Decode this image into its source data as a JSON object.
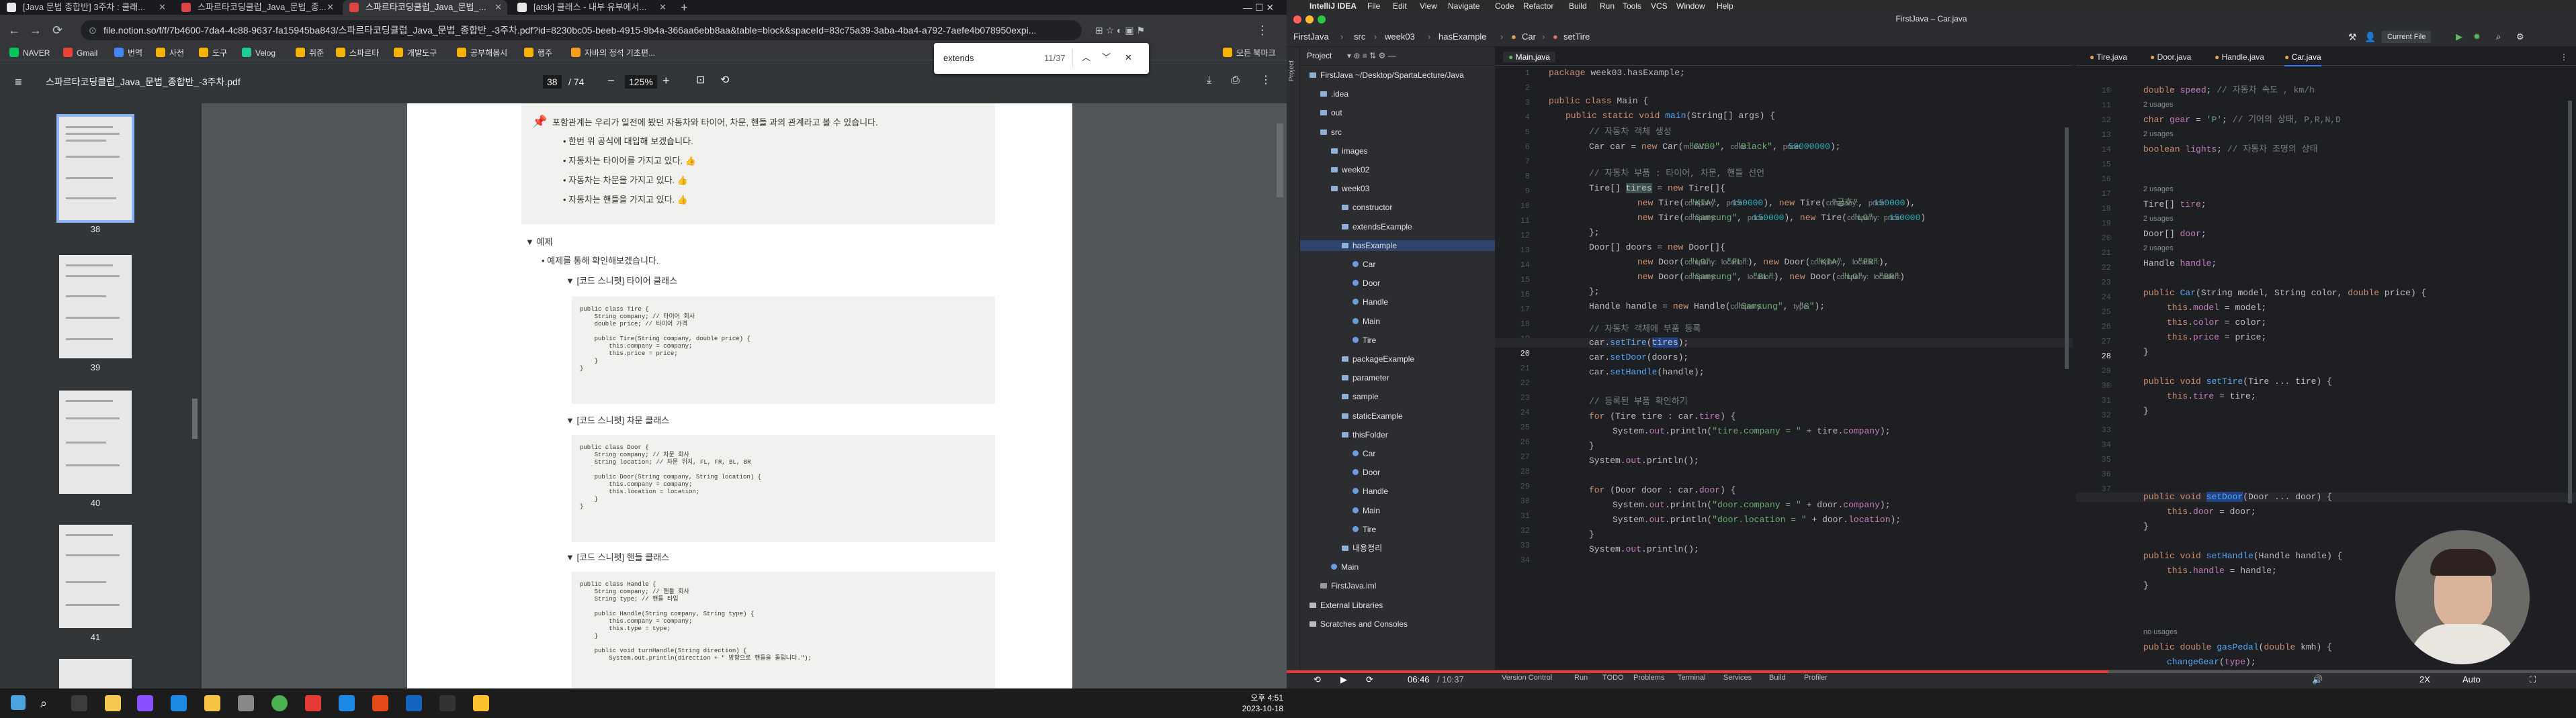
{
  "browser": {
    "tabs": [
      {
        "label": "[Java 문법 종합반] 3주차 : 클래..."
      },
      {
        "label": "스파르타코딩클럽_Java_문법_종..."
      },
      {
        "label": "스파르타코딩클럽_Java_문법_..."
      },
      {
        "label": "[atsk] 클래스 - 내부 유부에서..."
      }
    ],
    "url": "file.notion.so/f/f/7b4600-7da4-4c88-9637-fa15945ba843/스파르타코딩클럽_Java_문법_종합반_-3주차.pdf?id=8230bc05-beeb-4915-9b4a-366aa6ebb8aa&table=block&spaceId=83c75a39-3aba-4ba4-a792-7aefe4b078950expi...",
    "bookmarks": [
      "NAVER",
      "Gmail",
      "번역",
      "사전",
      "도구",
      "Velog",
      "취준",
      "스파르타",
      "개발도구",
      "공부해봅시",
      "행주",
      "자바의 정석 기초편...",
      "모든 북마크"
    ],
    "find": {
      "query": "extends",
      "count": "11/37"
    }
  },
  "pdf": {
    "filename": "스파르타코딩클럽_Java_문법_종합반_-3주차.pdf",
    "page_current": "38",
    "page_total": "/ 74",
    "zoom": "125%",
    "thumb_labels": [
      "38",
      "39",
      "40",
      "41"
    ],
    "callout_title": "포함관계는 우리가 일전에 봤던 자동차와 타이어, 차문, 핸들 과의 관계라고 볼 수 있습니다.",
    "callout_items": [
      "한번 위 공식에 대입해 보겠습니다.",
      "자동차는 타이어를 가지고 있다. 👍",
      "자동차는 차문을 가지고 있다. 👍",
      "자동차는 핸들을 가지고 있다. 👍"
    ],
    "example_toggle": "▼ 예제",
    "example_desc": "예제를 통해 확인해보겠습니다.",
    "sections": [
      {
        "title": "▼ [코드 스니펫] 타이어 클래스",
        "code": "public class Tire {\n    String company; // 타이어 회사\n    double price; // 타이어 가격\n\n    public Tire(String company, double price) {\n        this.company = company;\n        this.price = price;\n    }\n}"
      },
      {
        "title": "▼ [코드 스니펫] 차문 클래스",
        "code": "public class Door {\n    String company; // 차문 회사\n    String location; // 차문 위치, FL, FR, BL, BR\n\n    public Door(String company, String location) {\n        this.company = company;\n        this.location = location;\n    }\n}"
      },
      {
        "title": "▼ [코드 스니펫] 핸들 클래스",
        "code": "public class Handle {\n    String company; // 핸들 회사\n    String type; // 핸들 타입\n\n    public Handle(String company, String type) {\n        this.company = company;\n        this.type = type;\n    }\n\n    public void turnHandle(String direction) {\n        System.out.println(direction + \" 방향으로 핸들을 돌립니다.\");"
      }
    ]
  },
  "taskbar": {
    "time": "오후 4:51",
    "date": "2023-10-18"
  },
  "ide": {
    "mac_menu": [
      "IntelliJ IDEA",
      "File",
      "Edit",
      "View",
      "Navigate",
      "Code",
      "Refactor",
      "Build",
      "Run",
      "Tools",
      "VCS",
      "Window",
      "Help"
    ],
    "window_title": "FirstJava – Car.java",
    "breadcrumb": [
      "FirstJava",
      "src",
      "week03",
      "hasExample",
      "Car",
      "setTire"
    ],
    "run_config": "Current File",
    "project_label": "Project",
    "tree": [
      {
        "label": "FirstJava ~/Desktop/SpartaLecture/Java",
        "indent": 0,
        "kind": "module"
      },
      {
        "label": ".idea",
        "indent": 1,
        "kind": "folder"
      },
      {
        "label": "out",
        "indent": 1,
        "kind": "folder"
      },
      {
        "label": "src",
        "indent": 1,
        "kind": "folder"
      },
      {
        "label": "images",
        "indent": 2,
        "kind": "folder"
      },
      {
        "label": "week02",
        "indent": 2,
        "kind": "folder"
      },
      {
        "label": "week03",
        "indent": 2,
        "kind": "folder"
      },
      {
        "label": "constructor",
        "indent": 3,
        "kind": "folder"
      },
      {
        "label": "extendsExample",
        "indent": 3,
        "kind": "folder"
      },
      {
        "label": "hasExample",
        "indent": 3,
        "kind": "folder",
        "selected": true
      },
      {
        "label": "Car",
        "indent": 4,
        "kind": "class"
      },
      {
        "label": "Door",
        "indent": 4,
        "kind": "class"
      },
      {
        "label": "Handle",
        "indent": 4,
        "kind": "class"
      },
      {
        "label": "Main",
        "indent": 4,
        "kind": "class"
      },
      {
        "label": "Tire",
        "indent": 4,
        "kind": "class"
      },
      {
        "label": "packageExample",
        "indent": 3,
        "kind": "folder"
      },
      {
        "label": "parameter",
        "indent": 3,
        "kind": "folder"
      },
      {
        "label": "sample",
        "indent": 3,
        "kind": "folder"
      },
      {
        "label": "staticExample",
        "indent": 3,
        "kind": "folder"
      },
      {
        "label": "thisFolder",
        "indent": 3,
        "kind": "folder"
      },
      {
        "label": "Car",
        "indent": 4,
        "kind": "class"
      },
      {
        "label": "Door",
        "indent": 4,
        "kind": "class"
      },
      {
        "label": "Handle",
        "indent": 4,
        "kind": "class"
      },
      {
        "label": "Main",
        "indent": 4,
        "kind": "class"
      },
      {
        "label": "Tire",
        "indent": 4,
        "kind": "class"
      },
      {
        "label": "내용정리",
        "indent": 3,
        "kind": "folder"
      },
      {
        "label": "Main",
        "indent": 2,
        "kind": "class"
      },
      {
        "label": "FirstJava.iml",
        "indent": 1,
        "kind": "file"
      },
      {
        "label": "External Libraries",
        "indent": 0,
        "kind": "lib"
      },
      {
        "label": "Scratches and Consoles",
        "indent": 0,
        "kind": "lib"
      }
    ],
    "left_tab": "Main.java",
    "right_tabs": [
      "Tire.java",
      "Door.java",
      "Handle.java",
      "Car.java"
    ],
    "left_gutter": [
      "1",
      "2",
      "3",
      "4",
      "5",
      "6",
      "7",
      "8",
      "9",
      "10",
      "11",
      "12",
      "13",
      "14",
      "15",
      "16",
      "17",
      "18",
      "19",
      "20",
      "21",
      "22",
      "23",
      "24",
      "25",
      "26",
      "27",
      "28",
      "29",
      "30",
      "31",
      "32",
      "33",
      "34"
    ],
    "right_gutter": [
      "10",
      "11",
      "12",
      "13",
      "14",
      "15",
      "16",
      "17",
      "18",
      "19",
      "20",
      "21",
      "22",
      "23",
      "24",
      "25",
      "26",
      "27",
      "28",
      "29",
      "30",
      "31",
      "32",
      "33",
      "34",
      "35",
      "36",
      "37"
    ],
    "usages": [
      "2 usages",
      "2 usages",
      "2 usages",
      "2 usages",
      "2 usages",
      "2 usages",
      "no usages"
    ],
    "video": {
      "elapsed": "06:46",
      "total": "/ 10:37",
      "speed": "2X",
      "quality": "Auto"
    },
    "status_items": [
      "Version Control",
      "Run",
      "TODO",
      "Problems",
      "Terminal",
      "Services",
      "Build",
      "Profiler"
    ]
  }
}
